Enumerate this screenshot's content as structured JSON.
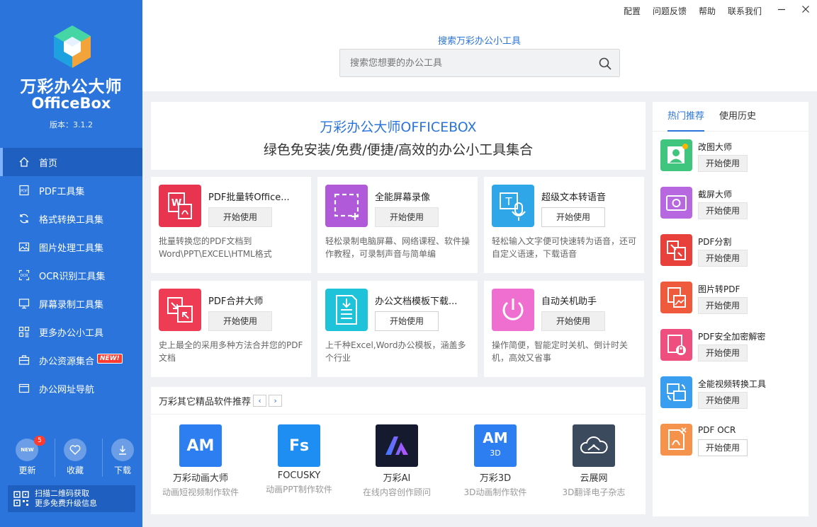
{
  "sidebar": {
    "brand_cn": "万彩办公大师",
    "brand_en": "OfficeBox",
    "version": "版本：3.1.2",
    "nav": [
      {
        "label": "首页",
        "icon": "home-icon",
        "active": true
      },
      {
        "label": "PDF工具集",
        "icon": "pdf-icon"
      },
      {
        "label": "格式转换工具集",
        "icon": "convert-icon"
      },
      {
        "label": "图片处理工具集",
        "icon": "image-icon"
      },
      {
        "label": "OCR识别工具集",
        "icon": "ocr-icon"
      },
      {
        "label": "屏幕录制工具集",
        "icon": "monitor-icon"
      },
      {
        "label": "更多办公小工具",
        "icon": "grid-icon"
      },
      {
        "label": "办公资源集合",
        "icon": "briefcase-icon",
        "new": "NEW!"
      },
      {
        "label": "办公网址导航",
        "icon": "browser-icon"
      }
    ],
    "bottom": {
      "update": "更新",
      "update_badge": "5",
      "update_icon_text": "NEW",
      "favorite": "收藏",
      "download": "下载"
    },
    "qr_line1": "扫描二维码获取",
    "qr_line2": "更多免费升级信息"
  },
  "toplinks": [
    "配置",
    "问题反馈",
    "帮助",
    "联系我们"
  ],
  "search": {
    "label": "搜索万彩办公小工具",
    "placeholder": "搜索您想要的办公工具"
  },
  "banner": {
    "title": "万彩办公大师OFFICEBOX",
    "subtitle": "绿色免安装/免费/便捷/高效的办公小工具集合"
  },
  "start_label": "开始使用",
  "cards": [
    {
      "name": "PDF批量转Office...",
      "desc": "批量转换您的PDF文档到Word\\PPT\\EXCEL\\HTML格式",
      "color": "#e8344e",
      "icon": "word-pdf-icon"
    },
    {
      "name": "全能屏幕录像",
      "desc": "轻松录制电脑屏幕、网络课程、软件操作教程，可录制声音与简单编",
      "color": "#b05ad9",
      "icon": "screen-record-icon"
    },
    {
      "name": "超级文本转语音",
      "desc": "轻松输入文字便可快速转为语音，还可自定义语速，下载语音",
      "color": "#2ea6e8",
      "icon": "text-to-speech-icon"
    },
    {
      "name": "PDF合并大师",
      "desc": "史上最全的采用多种方法合并您的PDF文档",
      "color": "#ef3c55",
      "icon": "pdf-merge-icon"
    },
    {
      "name": "办公文档模板下载...",
      "desc": "上千种Excel,Word办公模板，涵盖多个行业",
      "color": "#1fc3d9",
      "icon": "template-download-icon"
    },
    {
      "name": "自动关机助手",
      "desc": "操作简便，智能定时关机、倒计时关机，高效又省事",
      "color": "#ee6fcf",
      "icon": "power-icon"
    }
  ],
  "recommend": {
    "title": "万彩其它精品软件推荐",
    "prev": "‹",
    "next": "›",
    "products": [
      {
        "logo": "AM",
        "name": "万彩动画大师",
        "desc": "动画短视频制作软件",
        "color": "#2d7ef0"
      },
      {
        "logo": "Fs",
        "name": "FOCUSKY",
        "desc": "动画PPT制作软件",
        "color": "#1e8ef2"
      },
      {
        "logo": "AI",
        "name": "万彩AI",
        "desc": "在线内容创作顾问",
        "color": "#161a2e"
      },
      {
        "logo": "AM",
        "logo_sub": "3D",
        "name": "万彩3D",
        "desc": "3D动画制作软件",
        "color": "#2d7ef0"
      },
      {
        "logo": "",
        "name": "云展网",
        "desc": "3D翻译电子杂志",
        "color": "#3b4a5c"
      }
    ]
  },
  "side": {
    "tabs": [
      "热门推荐",
      "使用历史"
    ],
    "items": [
      {
        "name": "改图大师",
        "color": "#3fc57d",
        "icon": "photo-edit-icon"
      },
      {
        "name": "截屏大师",
        "color": "#b768e0",
        "icon": "screenshot-icon"
      },
      {
        "name": "PDF分割",
        "color": "#e8413c",
        "icon": "pdf-split-icon"
      },
      {
        "name": "图片转PDF",
        "color": "#f05a3c",
        "icon": "image-to-pdf-icon"
      },
      {
        "name": "PDF安全加密解密",
        "color": "#ee4f7e",
        "icon": "pdf-lock-icon"
      },
      {
        "name": "全能视频转换工具",
        "color": "#3a9ef0",
        "icon": "video-convert-icon"
      },
      {
        "name": "PDF OCR",
        "color": "#f5934d",
        "icon": "pdf-ocr-icon"
      }
    ]
  }
}
